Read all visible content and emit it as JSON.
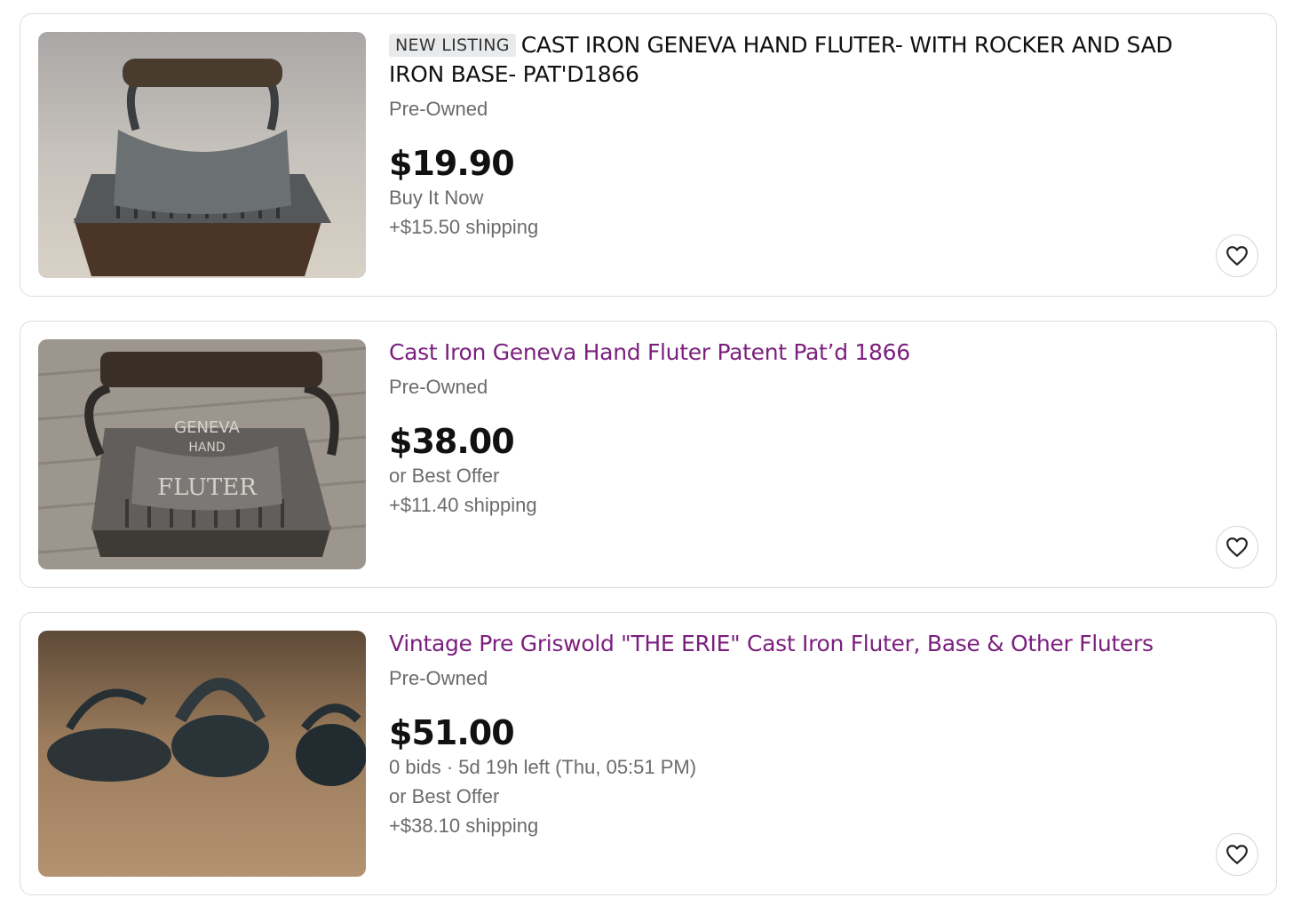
{
  "listings": [
    {
      "badge": "NEW LISTING",
      "title": "CAST IRON GENEVA HAND FLUTER- WITH ROCKER AND SAD IRON BASE- PAT'D1866",
      "condition": "Pre-Owned",
      "price": "$19.90",
      "format": "Buy It Now",
      "shipping": "+$15.50 shipping"
    },
    {
      "title": "Cast Iron Geneva Hand Fluter Patent Pat’d 1866",
      "condition": "Pre-Owned",
      "price": "$38.00",
      "format": "or Best Offer",
      "shipping": "+$11.40 shipping"
    },
    {
      "title": "Vintage Pre Griswold \"THE ERIE\" Cast Iron Fluter, Base & Other Fluters",
      "condition": "Pre-Owned",
      "price": "$51.00",
      "bids": "0 bids · 5d 19h left (Thu, 05:51 PM)",
      "format": "or Best Offer",
      "shipping": "+$38.10 shipping"
    }
  ],
  "image_text": {
    "engraving_1": "GENEVA",
    "engraving_2": "HAND",
    "engraving_3": "FLUTER"
  },
  "icons": {
    "favorite": "heart-icon"
  },
  "colors": {
    "visited_link": "#7b1f7e",
    "text": "#111111",
    "secondary": "#6b6b6b",
    "badge_bg": "#e9eaec"
  }
}
